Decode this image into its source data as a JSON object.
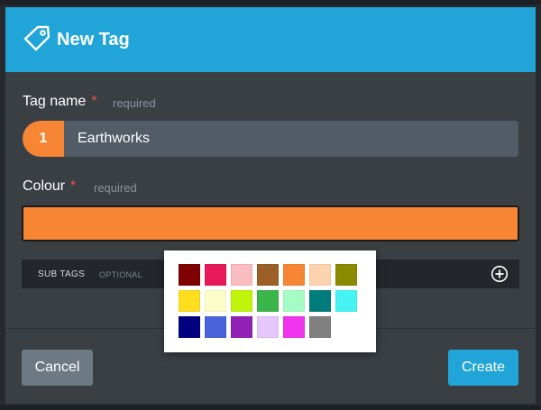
{
  "modal": {
    "title": "New Tag",
    "icon": "tag-icon",
    "header_color": "#21a5d8"
  },
  "tag_name": {
    "label": "Tag name",
    "required_star": "*",
    "required_text": "required",
    "badge": "1",
    "badge_color": "#f68634",
    "value": "Earthworks"
  },
  "colour": {
    "label": "Colour",
    "required_star": "*",
    "required_text": "required",
    "selected_color": "#f68634"
  },
  "sub_tags": {
    "label": "SUB TAGS",
    "optional_text": "OPTIONAL",
    "add_icon": "plus-circle-icon"
  },
  "palette": {
    "swatches": [
      "#7f0000",
      "#e8195a",
      "#f9bcbf",
      "#9b5f27",
      "#f68634",
      "#fdd3ae",
      "#8b8a00",
      "#fede1d",
      "#fdfdc8",
      "#bff307",
      "#3ab54a",
      "#a4fdc4",
      "#007c7c",
      "#46f3f3",
      "#000080",
      "#4a63db",
      "#9121b4",
      "#e6c6fb",
      "#f134ed",
      "#808080"
    ]
  },
  "footer": {
    "cancel_label": "Cancel",
    "create_label": "Create"
  }
}
